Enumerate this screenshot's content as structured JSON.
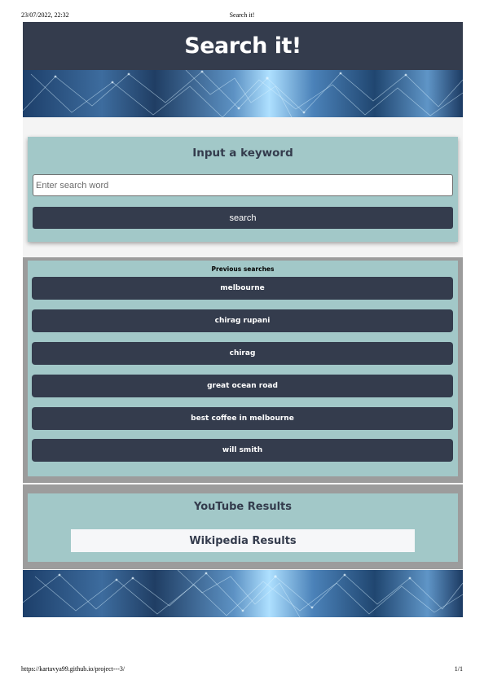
{
  "print": {
    "date": "23/07/2022, 22:32",
    "title": "Search it!",
    "url": "https://kartavya99.github.io/project---3/",
    "page": "1/1"
  },
  "header": {
    "title": "Search it!",
    "bg_color": "#343c4d"
  },
  "search": {
    "heading": "Input a keyword",
    "placeholder": "Enter search word",
    "value": "",
    "button_label": "search"
  },
  "history": {
    "heading": "Previous searches",
    "items": [
      "melbourne",
      "chirag rupani",
      "chirag",
      "great ocean road",
      "best coffee in melbourne",
      "will smith"
    ]
  },
  "results": {
    "youtube_heading": "YouTube Results",
    "wikipedia_heading": "Wikipedia Results"
  },
  "colors": {
    "panel": "#a2c8c8",
    "dark": "#343c4d",
    "frame": "#9c9c9c",
    "page_bg": "#f4f4f4"
  }
}
